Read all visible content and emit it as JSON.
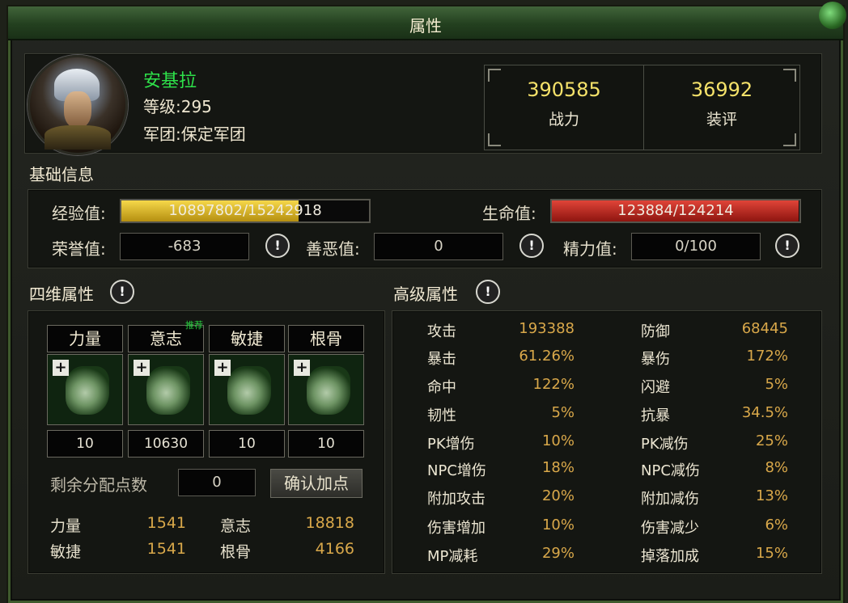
{
  "title": "属性",
  "character": {
    "name": "安基拉",
    "level": "等级:295",
    "legion": "军团:保定军团"
  },
  "power": {
    "value": "390585",
    "label": "战力"
  },
  "gear_score": {
    "value": "36992",
    "label": "装评"
  },
  "basic": {
    "title": "基础信息",
    "exp_label": "经验值:",
    "exp_text": "10897802/15242918",
    "exp_fraction": 0.715,
    "hp_label": "生命值:",
    "hp_text": "123884/124214",
    "hp_fraction": 0.997,
    "honor_label": "荣誉值:",
    "honor_value": "-683",
    "karma_label": "善恶值:",
    "karma_value": "0",
    "energy_label": "精力值:",
    "energy_value": "0/100"
  },
  "four_dim": {
    "title": "四维属性",
    "recommend": "推荐",
    "attrs": [
      {
        "label": "力量",
        "value": "10"
      },
      {
        "label": "意志",
        "value": "10630"
      },
      {
        "label": "敏捷",
        "value": "10"
      },
      {
        "label": "根骨",
        "value": "10"
      }
    ],
    "remaining_label": "剩余分配点数",
    "remaining_value": "0",
    "confirm_button": "确认加点",
    "totals": [
      {
        "label": "力量",
        "value": "1541"
      },
      {
        "label": "意志",
        "value": "18818"
      },
      {
        "label": "敏捷",
        "value": "1541"
      },
      {
        "label": "根骨",
        "value": "4166"
      }
    ]
  },
  "advanced": {
    "title": "高级属性",
    "left": [
      {
        "label": "攻击",
        "value": "193388"
      },
      {
        "label": "暴击",
        "value": "61.26%"
      },
      {
        "label": "命中",
        "value": "122%"
      },
      {
        "label": "韧性",
        "value": "5%"
      },
      {
        "label": "PK增伤",
        "value": "10%"
      },
      {
        "label": "NPC增伤",
        "value": "18%"
      },
      {
        "label": "附加攻击",
        "value": "20%"
      },
      {
        "label": "伤害增加",
        "value": "10%"
      },
      {
        "label": "MP减耗",
        "value": "29%"
      }
    ],
    "right": [
      {
        "label": "防御",
        "value": "68445"
      },
      {
        "label": "暴伤",
        "value": "172%"
      },
      {
        "label": "闪避",
        "value": "5%"
      },
      {
        "label": "抗暴",
        "value": "34.5%"
      },
      {
        "label": "PK减伤",
        "value": "25%"
      },
      {
        "label": "NPC减伤",
        "value": "8%"
      },
      {
        "label": "附加减伤",
        "value": "13%"
      },
      {
        "label": "伤害减少",
        "value": "6%"
      },
      {
        "label": "掉落加成",
        "value": "15%"
      }
    ]
  },
  "colors": {
    "exp_bar": "#e7c21d",
    "hp_bar": "#c8211b",
    "name": "#2ee24a",
    "value": "#d9a84a"
  }
}
